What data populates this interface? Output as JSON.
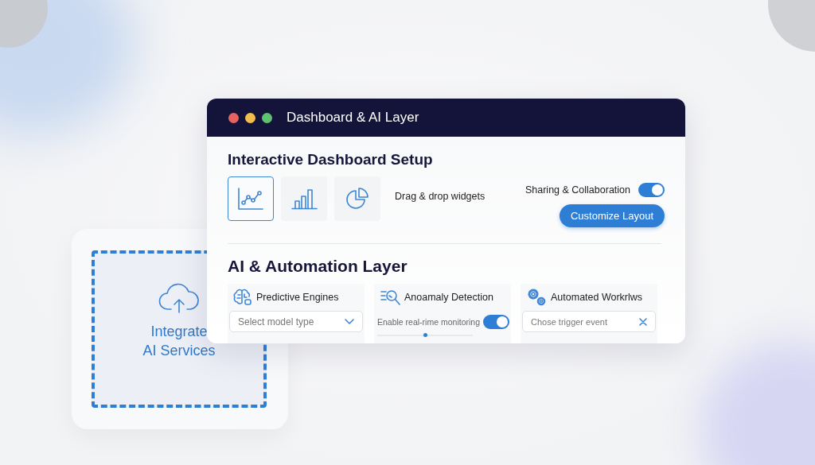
{
  "integration": {
    "label": "Integrate\nAI Services"
  },
  "window": {
    "title": "Dashboard & AI Layer",
    "controls": [
      {
        "color": "#e8625f"
      },
      {
        "color": "#f2bd4e"
      },
      {
        "color": "#5ec26f"
      }
    ]
  },
  "dashboard_setup": {
    "heading": "Interactive Dashboard Setup",
    "widgets": [
      {
        "kind": "line",
        "selected": true
      },
      {
        "kind": "bar",
        "selected": false
      },
      {
        "kind": "pie",
        "selected": false
      }
    ],
    "hint": "Drag & drop widgets",
    "sharing": {
      "label": "Sharing & Collaboration",
      "on": true
    },
    "button": "Customize Layout"
  },
  "automation": {
    "heading": "AI & Automation Layer",
    "modules": [
      {
        "kind": "dropdown",
        "title": "Predictive Engines",
        "placeholder": "Select model type"
      },
      {
        "kind": "toggle",
        "title": "Anoamaly Detection",
        "label": "Enable real-rime monitoring",
        "on": true,
        "level": 0.5
      },
      {
        "kind": "field",
        "title": "Automated Workrlws",
        "placeholder": "Chose trigger event"
      }
    ]
  }
}
